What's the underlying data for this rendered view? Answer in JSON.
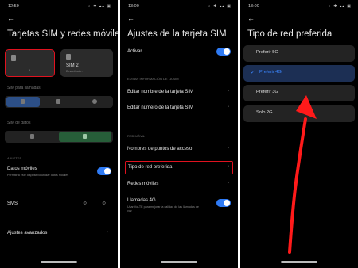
{
  "status": {
    "p1_time": "12:59",
    "p2_time": "13:00",
    "p3_time": "13:00",
    "icons": "◐ ✱ ▴▴ ▣"
  },
  "panel1": {
    "title": "Tarjetas SIM y redes móviles",
    "sim1": {
      "icon": "sim-card-icon",
      "arrow": "›"
    },
    "sim2": {
      "name": "SIM 2",
      "sub": "Desactivado  ›"
    },
    "sim_calls_label": "SIM para llamadas",
    "sim_data_label": "SIM de datos",
    "ajustes_label": "AJUSTES",
    "mobile_data": {
      "title": "Datos móviles",
      "sub": "Permitir a este dispositivo utilizar datos móviles",
      "on": true
    },
    "sms_label": "SMS",
    "advanced_label": "Ajustes avanzados"
  },
  "panel2": {
    "title": "Ajustes de la tarjeta SIM",
    "activar": {
      "label": "Activar",
      "on": true
    },
    "edit_section": "EDITAR INFORMACIÓN DE LA SIM",
    "edit_name": "Editar nombre de la tarjeta SIM",
    "edit_number": "Editar número de la tarjeta SIM",
    "movil_section": "RED MÓVIL",
    "apn": "Nombres de puntos de acceso",
    "net_type": "Tipo de red preferida",
    "mobile_nets": "Redes móviles",
    "calls4g": {
      "title": "Llamadas 4G",
      "sub": "Usar VoLTE para mejorar la calidad de las llamadas de",
      "sub2": "voz",
      "on": true
    }
  },
  "panel3": {
    "title": "Tipo de red preferida",
    "options": [
      "Preferir 5G",
      "Preferir 4G",
      "Preferir 3G",
      "Solo 2G"
    ],
    "selected_index": 1
  },
  "colors": {
    "accent": "#2f7bf5",
    "highlight": "#e0121f",
    "selected_text": "#3b86ff"
  }
}
